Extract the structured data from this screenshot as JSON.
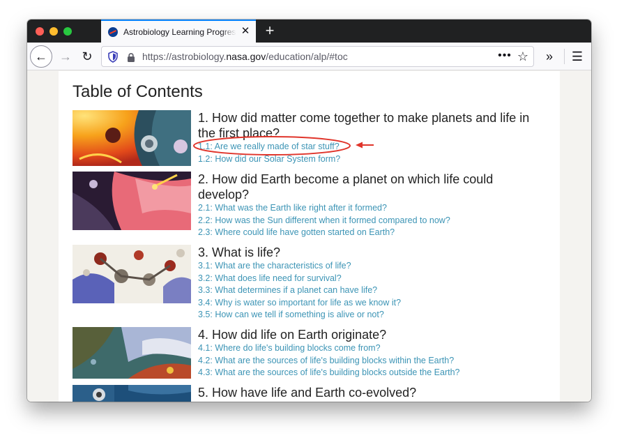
{
  "browser": {
    "tab": {
      "title": "Astrobiology Learning Progress",
      "close_glyph": "✕"
    },
    "new_tab_glyph": "+",
    "nav": {
      "back_glyph": "←",
      "forward_glyph": "→",
      "reload_glyph": "↻",
      "overflow_glyph": "»",
      "menu_glyph": "☰"
    },
    "url": {
      "prefix": "https://astrobiology.",
      "domain": "nasa.gov",
      "path": "/education/alp/#toc",
      "more_glyph": "•••",
      "star_glyph": "☆"
    }
  },
  "page": {
    "title": "Table of Contents",
    "sections": [
      {
        "heading": "1.  How did matter come together to make planets and life in the first place?",
        "links": [
          "1.1: Are we really made of star stuff?",
          "1.2: How did our Solar System form?"
        ]
      },
      {
        "heading": "2.  How did Earth become a planet on which life could develop?",
        "links": [
          "2.1: What was the Earth like right after it formed?",
          "2.2: How was the Sun different when it formed compared to now?",
          "2.3: Where could life have gotten started on Earth?"
        ]
      },
      {
        "heading": "3.  What is life?",
        "links": [
          "3.1: What are the characteristics of life?",
          "3.2: What does life need for survival?",
          "3.3: What determines if a planet can have life?",
          "3.4: Why is water so important for life as we know it?",
          "3.5: How can we tell if something is alive or not?"
        ]
      },
      {
        "heading": "4.  How did life on Earth originate?",
        "links": [
          "4.1: Where do life's building blocks come from?",
          "4.2: What are the sources of life's building blocks within the Earth?",
          "4.3: What are the sources of life's building blocks outside the Earth?"
        ]
      },
      {
        "heading": "5.  How have life and Earth co-evolved?",
        "links": []
      }
    ]
  },
  "colors": {
    "link": "#3c94b5",
    "annotation": "#e0342a",
    "tab_accent": "#0a84ff"
  }
}
